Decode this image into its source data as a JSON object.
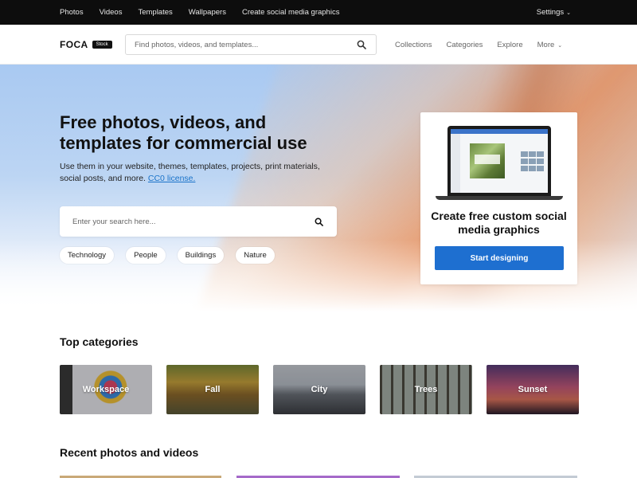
{
  "topbar": {
    "links": [
      "Photos",
      "Videos",
      "Templates",
      "Wallpapers",
      "Create social media graphics"
    ],
    "settings": "Settings"
  },
  "header": {
    "logo": "FOCA",
    "logo_badge": "Stock",
    "search_placeholder": "Find photos, videos, and templates...",
    "nav": [
      "Collections",
      "Categories",
      "Explore",
      "More"
    ]
  },
  "hero": {
    "title": "Free photos, videos, and templates for commercial use",
    "subtitle": "Use them in your website, themes, templates, projects, print materials, social posts, and more.",
    "license_link": "CC0 license.",
    "search_placeholder": "Enter your search here...",
    "tags": [
      "Technology",
      "People",
      "Buildings",
      "Nature"
    ]
  },
  "promo": {
    "title": "Create free custom social media graphics",
    "button": "Start designing"
  },
  "top_categories": {
    "title": "Top categories",
    "items": [
      "Workspace",
      "Fall",
      "City",
      "Trees",
      "Sunset"
    ]
  },
  "recent": {
    "title": "Recent photos and videos"
  },
  "colors": {
    "accent": "#1e6fd0",
    "link": "#1a73c9",
    "topbar_bg": "#0d0d0d"
  }
}
